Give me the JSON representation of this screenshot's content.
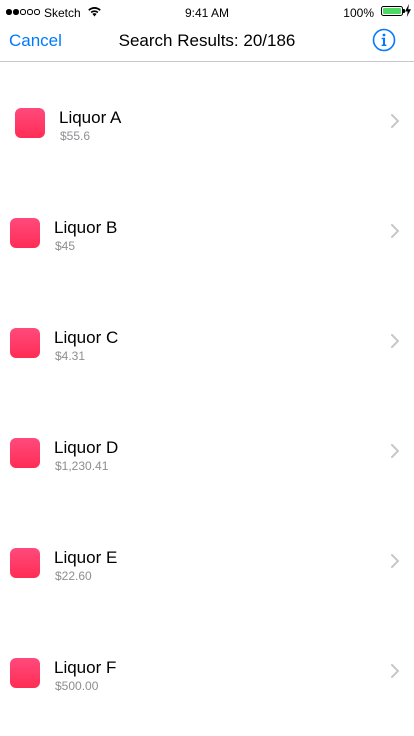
{
  "status_bar": {
    "carrier": "Sketch",
    "time": "9:41 AM",
    "battery": "100%",
    "battery_level": 1.0,
    "signal_bars_filled": 2,
    "signal_bars_total": 5
  },
  "nav": {
    "cancel_label": "Cancel",
    "title": "Search Results: 20/186",
    "info_icon": "info-circle-icon"
  },
  "colors": {
    "accent": "#007aff",
    "item_thumbnail": "#ff2d55",
    "secondary_text": "#8e8e93"
  },
  "results": [
    {
      "title": "Liquor A",
      "price": "$55.6"
    },
    {
      "title": "Liquor B",
      "price": "$45"
    },
    {
      "title": "Liquor C",
      "price": "$4.31"
    },
    {
      "title": "Liquor D",
      "price": "$1,230.41"
    },
    {
      "title": "Liquor E",
      "price": "$22.60"
    },
    {
      "title": "Liquor F",
      "price": "$500.00"
    }
  ]
}
